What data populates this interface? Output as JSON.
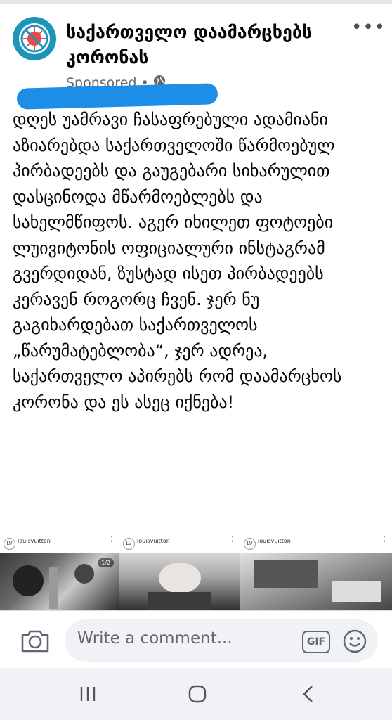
{
  "post": {
    "page_name": "საქართველო დაამარცხებს კორონას",
    "sponsored": "Sponsored",
    "privacy_icon": "globe-icon",
    "text": "დღეს უამრავი ჩასაფრებული ადამიანი აზიარებდა საქართველოში წარმოებულ პირბადეებს და გაუგებარი სიხარულით დასცინოდა მწარმოებლებს და სახელმწიფოს. აგერ იხილეთ ფოტოები ლუივიტონის ოფიციალური ინსტაგრამ გვერდიდან, ზუსტად ისეთ პირბადეებს კერავენ როგორც ჩვენ. ჯერ ნუ გაგიხარდებათ საქართველოს „წარუმატებლობა“, ჯერ ადრეა, საქართველო აპირებს რომ დაამარცხოს კორონა და ეს ასეც იქნება!"
  },
  "gallery": {
    "photos": [
      {
        "user": "louisvuitton",
        "counter": "1/2",
        "avatar": "LV"
      },
      {
        "user": "louisvuitton",
        "avatar": "LV"
      },
      {
        "user": "louisvuitton",
        "avatar": "LV"
      }
    ]
  },
  "comment": {
    "placeholder": "Write a comment...",
    "gif_label": "GIF"
  },
  "colors": {
    "brand": "#1b95b8",
    "scribble": "#1d8ee8",
    "text": "#050505",
    "muted": "#65676b"
  }
}
